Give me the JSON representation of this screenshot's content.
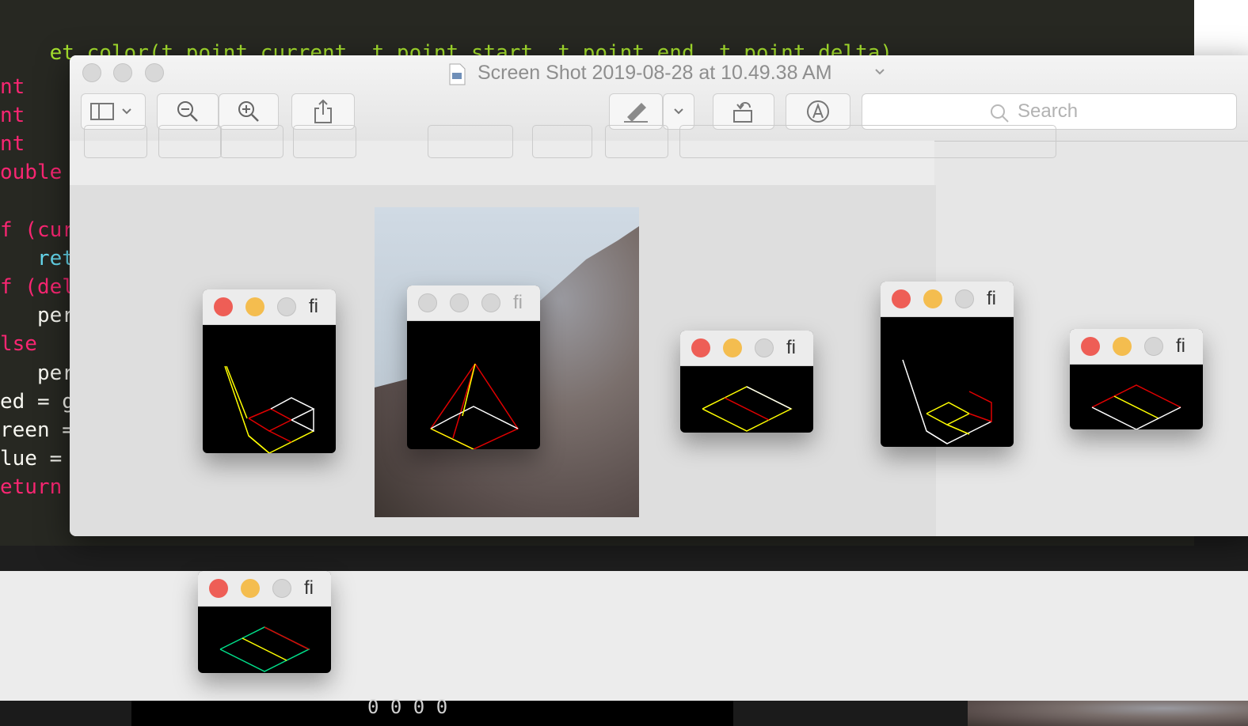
{
  "editor": {
    "lines": [
      "et_color(t_point current, t_point start, t_point end, t_point delta)",
      "nt",
      "nt",
      "nt",
      "ouble",
      "",
      "f (cur",
      "   ret",
      "f (del",
      "   per",
      "lse",
      "   per",
      "ed = g",
      "reen =",
      "lue = ",
      "eturn"
    ]
  },
  "preview": {
    "title": "Screen Shot 2019-08-28 at 10.49.38 AM",
    "search_placeholder": "Search"
  },
  "fdf_windows": [
    {
      "title": "fi"
    },
    {
      "title": "fi"
    },
    {
      "title": "fi"
    },
    {
      "title": "fi"
    },
    {
      "title": "fi"
    },
    {
      "title": "fi"
    }
  ],
  "terminal": {
    "text": "0 0 0 0"
  },
  "colors": {
    "close": "#ee5e56",
    "minimize": "#f4bd4f",
    "editor_bg": "#272822",
    "wire_yellow": "#ffff00",
    "wire_red": "#e00000",
    "wire_white": "#ffffff",
    "wire_green": "#00e08a"
  }
}
